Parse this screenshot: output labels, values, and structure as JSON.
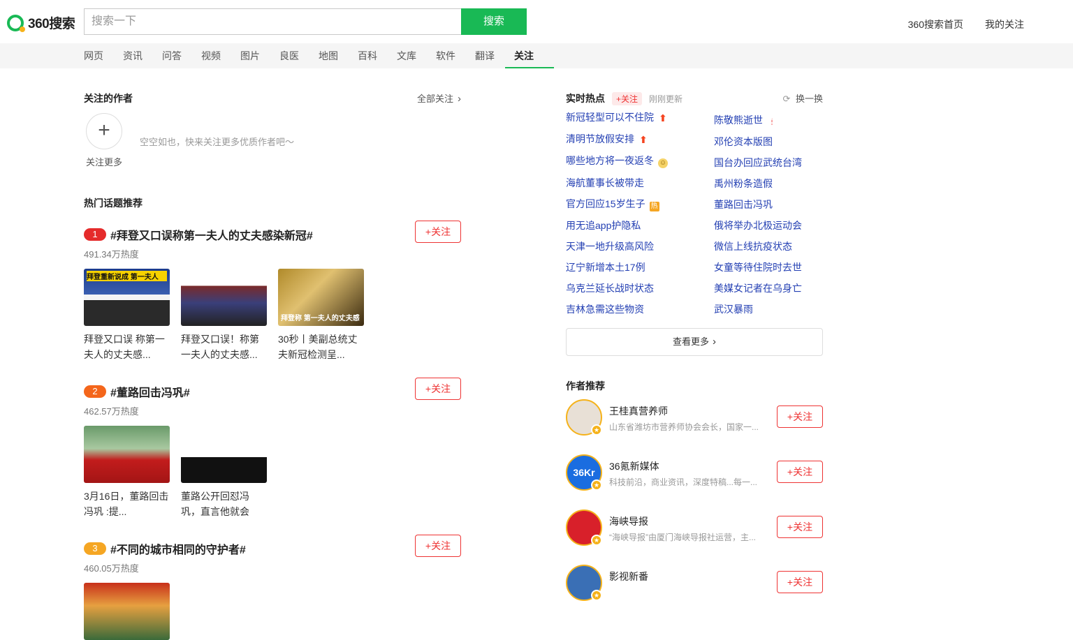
{
  "header": {
    "logo_text": "360搜索",
    "search_placeholder": "搜索一下",
    "search_button": "搜索",
    "links": [
      "360搜索首页",
      "我的关注"
    ]
  },
  "nav": {
    "items": [
      "网页",
      "资讯",
      "问答",
      "视频",
      "图片",
      "良医",
      "地图",
      "百科",
      "文库",
      "软件",
      "翻译",
      "关注"
    ],
    "active": "关注"
  },
  "followed_authors": {
    "title": "关注的作者",
    "all_link": "全部关注",
    "add_label": "关注更多",
    "empty_tip": "空空如也，快来关注更多优质作者吧～"
  },
  "hot_topics": {
    "title": "热门话题推荐",
    "follow_label": "+关注",
    "items": [
      {
        "rank": "1",
        "rank_color": "#e52b2b",
        "title": "#拜登又口误称第一夫人的丈夫感染新冠#",
        "heat": "491.34万热度",
        "thumbs": [
          {
            "caption": "拜登又口误 称第一夫人的丈夫感...",
            "overlay": "拜登重新说成 第一夫人"
          },
          {
            "caption": "拜登又口误！称第一夫人的丈夫感...",
            "overlay": ""
          },
          {
            "caption": "30秒丨美副总统丈夫新冠检测呈...",
            "overlay": "拜登称 第一夫人的丈夫感"
          }
        ]
      },
      {
        "rank": "2",
        "rank_color": "#f4661b",
        "title": "#董路回击冯巩#",
        "heat": "462.57万热度",
        "thumbs": [
          {
            "caption": "3月16日，董路回击冯巩 :提...",
            "overlay": ""
          },
          {
            "caption": "董路公开回怼冯巩，直言他就会",
            "overlay": ""
          }
        ]
      },
      {
        "rank": "3",
        "rank_color": "#f5a623",
        "title": "#不同的城市相同的守护者#",
        "heat": "460.05万热度",
        "thumbs": []
      }
    ]
  },
  "realtime_hot": {
    "title": "实时热点",
    "follow_label": "+关注",
    "update_text": "刚刚更新",
    "refresh_label": "换一换",
    "left_items": [
      {
        "text": "新冠轻型可以不住院",
        "tag": "up"
      },
      {
        "text": "清明节放假安排",
        "tag": "up"
      },
      {
        "text": "哪些地方将一夜返冬",
        "tag": "emoji"
      },
      {
        "text": "海航董事长被带走",
        "tag": ""
      },
      {
        "text": "官方回应15岁生子",
        "tag": "hot"
      },
      {
        "text": "用无追app护隐私",
        "tag": ""
      },
      {
        "text": "天津一地升级高风险",
        "tag": ""
      },
      {
        "text": "辽宁新增本土17例",
        "tag": ""
      },
      {
        "text": "乌克兰延长战时状态",
        "tag": ""
      },
      {
        "text": "吉林急需这些物资",
        "tag": ""
      }
    ],
    "right_items": [
      {
        "text": "陈敬熊逝世",
        "tag": "candle"
      },
      {
        "text": "邓伦资本版图",
        "tag": ""
      },
      {
        "text": "国台办回应武统台湾",
        "tag": ""
      },
      {
        "text": "禹州粉条造假",
        "tag": ""
      },
      {
        "text": "董路回击冯巩",
        "tag": ""
      },
      {
        "text": "俄将举办北极运动会",
        "tag": ""
      },
      {
        "text": "微信上线抗疫状态",
        "tag": ""
      },
      {
        "text": "女童等待住院时去世",
        "tag": ""
      },
      {
        "text": "美媒女记者在乌身亡",
        "tag": ""
      },
      {
        "text": "武汉暴雨",
        "tag": ""
      }
    ],
    "hot_tag_text": "热",
    "more_label": "查看更多"
  },
  "author_recommend": {
    "title": "作者推荐",
    "follow_label": "+关注",
    "items": [
      {
        "name": "王桂真营养师",
        "desc": "山东省潍坊市营养师协会会长，国家一...",
        "avatar_color": "#e8e0d6",
        "avatar_text": ""
      },
      {
        "name": "36氪新媒体",
        "desc": "科技前沿，商业资讯，深度特稿...每一...",
        "avatar_color": "#1a6de0",
        "avatar_text": "36Kr"
      },
      {
        "name": "海峡导报",
        "desc": "“海峡导报”由厦门海峡导报社运营，主...",
        "avatar_color": "#d8202a",
        "avatar_text": ""
      },
      {
        "name": "影视新番",
        "desc": "",
        "avatar_color": "#3a6fb5",
        "avatar_text": ""
      }
    ]
  }
}
